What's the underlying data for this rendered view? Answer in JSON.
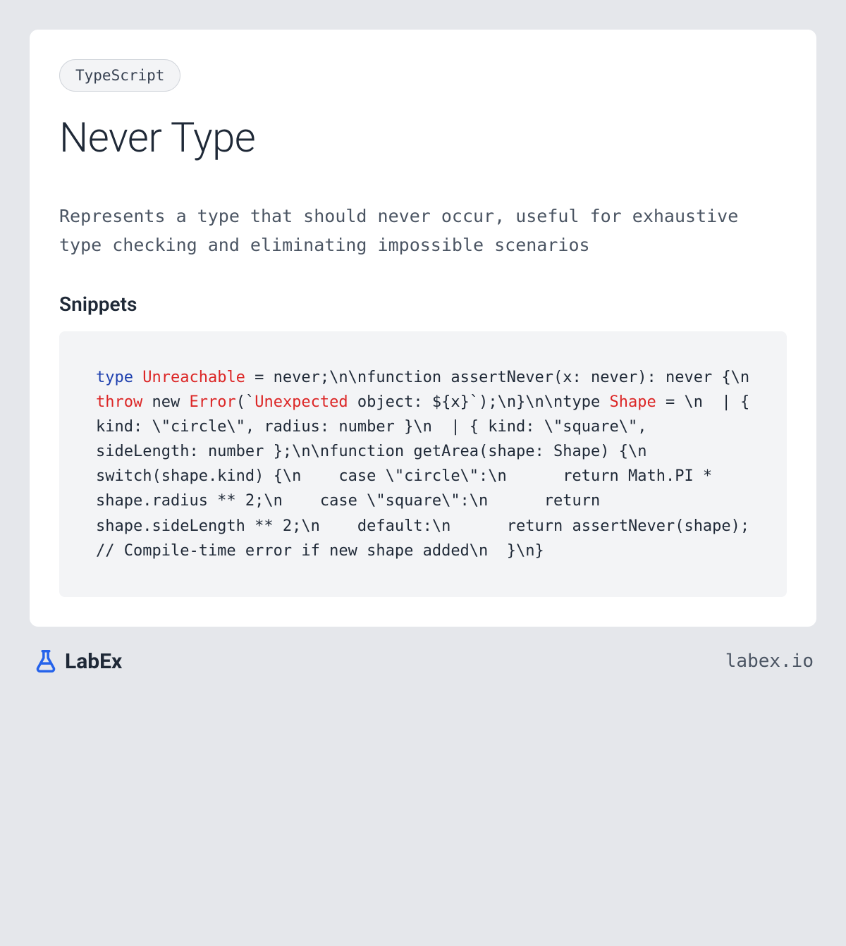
{
  "tag": "TypeScript",
  "title": "Never Type",
  "description": "Represents a type that should never occur, useful for exhaustive type checking and eliminating impossible scenarios",
  "sectionHeading": "Snippets",
  "code": {
    "t1": "type",
    "t2": "Unreachable",
    "t3": " = never;\\n\\nfunction assertNever(x: never): never {\\n  ",
    "t4": "throw",
    "t5": " new ",
    "t6": "Error",
    "t7": "(`",
    "t8": "Unexpected",
    "t9": " object: ${x}`);\\n}\\n\\ntype ",
    "t10": "Shape",
    "t11": " = \\n  | { kind: \\\"circle\\\", radius: number }\\n  | { kind: \\\"square\\\", sideLength: number };\\n\\nfunction getArea(shape: Shape) {\\n  switch(shape.kind) {\\n    case \\\"circle\\\":\\n      return Math.PI * shape.radius ** 2;\\n    case \\\"square\\\":\\n      return shape.sideLength ** 2;\\n    default:\\n      return assertNever(shape); // Compile-time error if new shape added\\n  }\\n}"
  },
  "footer": {
    "brand": "LabEx",
    "url": "labex.io"
  }
}
